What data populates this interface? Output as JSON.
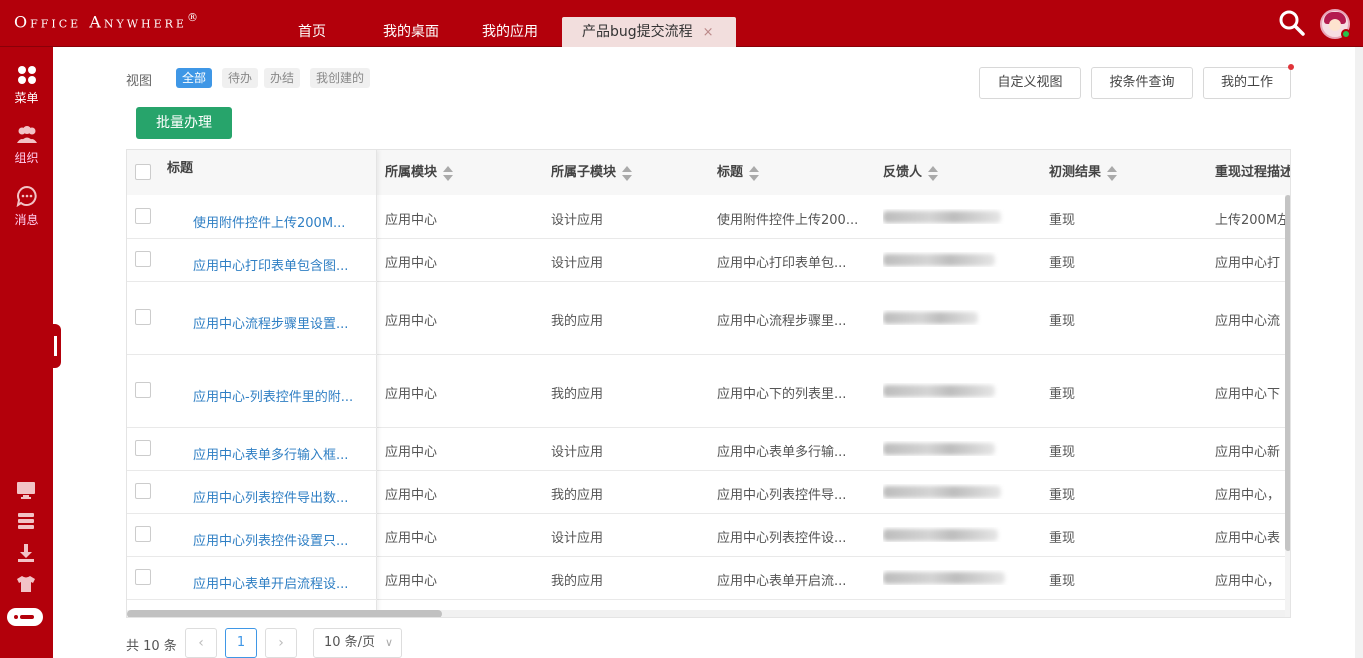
{
  "app": {
    "logo_text": "Office Anywhere",
    "logo_mark": "®",
    "nav_tabs": [
      {
        "label": "首页"
      },
      {
        "label": "我的桌面"
      },
      {
        "label": "我的应用"
      }
    ],
    "active_tab": {
      "label": "产品bug提交流程",
      "close": "×"
    },
    "accent_color": "#b3000b"
  },
  "sidebar": {
    "items": [
      {
        "label": "菜单",
        "icon": "grid-icon"
      },
      {
        "label": "组织",
        "icon": "people-icon"
      },
      {
        "label": "消息",
        "icon": "chat-icon"
      }
    ],
    "bottom_icons": [
      "monitor-icon",
      "layers-icon",
      "download-icon",
      "tshirt-icon",
      "toggle-icon"
    ]
  },
  "toolbar": {
    "view_label": "视图",
    "view_tabs": [
      {
        "label": "全部",
        "active": true
      },
      {
        "label": "待办",
        "active": false
      },
      {
        "label": "办结",
        "active": false
      },
      {
        "label": "我创建的",
        "active": false
      }
    ],
    "custom_view": "自定义视图",
    "query": "按条件查询",
    "my_work": "我的工作",
    "batch": "批量办理"
  },
  "table": {
    "fixed_header": "标题",
    "columns": [
      "所属模块",
      "所属子模块",
      "标题",
      "反馈人",
      "初测结果",
      "重现过程描述"
    ],
    "rows": [
      {
        "title": "使用附件控件上传200M...",
        "module": "应用中心",
        "sub": "设计应用",
        "title2": "使用附件控件上传200...",
        "feedback": "",
        "result": "重现",
        "desc": "上传200M左"
      },
      {
        "title": "应用中心打印表单包含图...",
        "module": "应用中心",
        "sub": "设计应用",
        "title2": "应用中心打印表单包...",
        "feedback": "",
        "result": "重现",
        "desc": "应用中心打"
      },
      {
        "title": "应用中心流程步骤里设置...",
        "module": "应用中心",
        "sub": "我的应用",
        "title2": "应用中心流程步骤里...",
        "feedback": "",
        "result": "重现",
        "desc": "应用中心流"
      },
      {
        "title": "应用中心-列表控件里的附...",
        "module": "应用中心",
        "sub": "我的应用",
        "title2": "应用中心下的列表里...",
        "feedback": "",
        "result": "重现",
        "desc": "应用中心下"
      },
      {
        "title": "应用中心表单多行输入框...",
        "module": "应用中心",
        "sub": "设计应用",
        "title2": "应用中心表单多行输...",
        "feedback": "",
        "result": "重现",
        "desc": "应用中心新"
      },
      {
        "title": "应用中心列表控件导出数...",
        "module": "应用中心",
        "sub": "我的应用",
        "title2": "应用中心列表控件导...",
        "feedback": "",
        "result": "重现",
        "desc": "应用中心，"
      },
      {
        "title": "应用中心列表控件设置只...",
        "module": "应用中心",
        "sub": "设计应用",
        "title2": "应用中心列表控件设...",
        "feedback": "",
        "result": "重现",
        "desc": "应用中心表"
      },
      {
        "title": "应用中心表单开启流程设...",
        "module": "应用中心",
        "sub": "我的应用",
        "title2": "应用中心表单开启流...",
        "feedback": "",
        "result": "重现",
        "desc": "应用中心，"
      }
    ]
  },
  "pager": {
    "total": "共 10 条",
    "prev": "‹",
    "current": "1",
    "next": "›",
    "page_size": "10 条/页",
    "caret": "∨"
  }
}
